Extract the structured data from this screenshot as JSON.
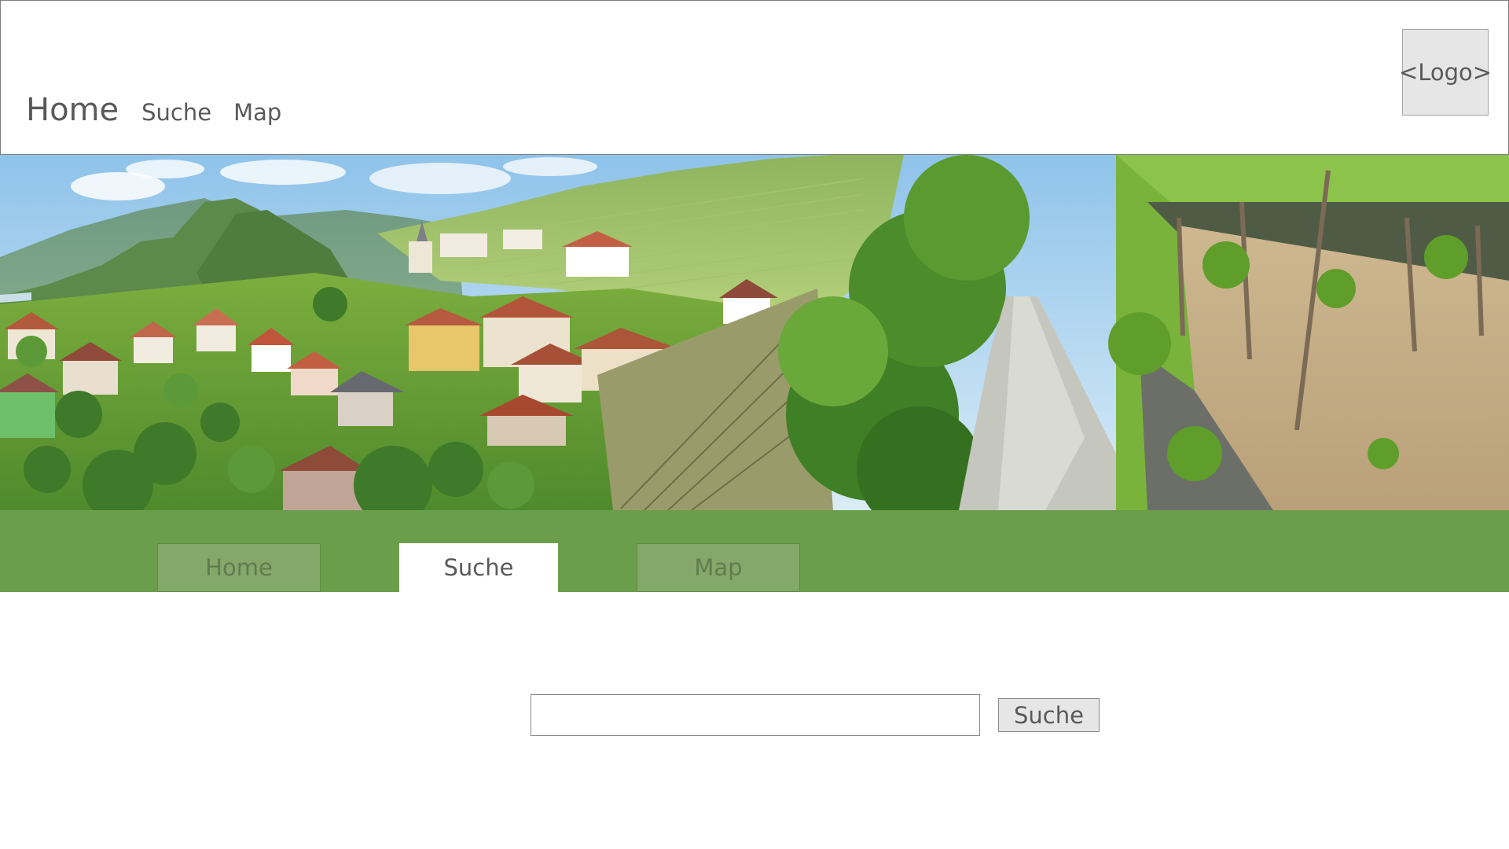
{
  "header": {
    "nav": {
      "home": "Home",
      "suche": "Suche",
      "map": "Map"
    },
    "logo": "<Logo>"
  },
  "tabs": {
    "home": "Home",
    "suche": "Suche",
    "map": "Map",
    "active": "suche"
  },
  "search": {
    "value": "",
    "placeholder": "",
    "button_label": "Suche"
  },
  "colors": {
    "tabbar": "#6a9e4b",
    "tab_inactive": "#84a86a",
    "tab_active": "#ffffff",
    "text": "#595959"
  }
}
